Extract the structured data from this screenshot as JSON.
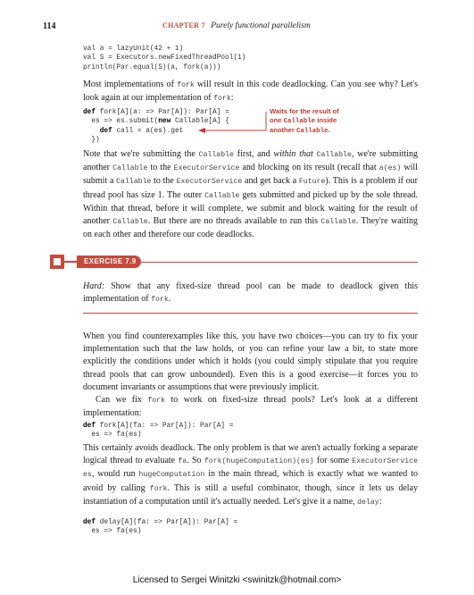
{
  "header": {
    "page_number": "114",
    "chapter_label": "CHAPTER 7",
    "chapter_title": "Purely functional parallelism"
  },
  "code1": {
    "l1": "val a = lazyUnit(42 + 1)",
    "l2": "val S = Executors.newFixedThreadPool(1)",
    "l3": "println(Par.equal(S)(a, fork(a)))"
  },
  "p1": {
    "a": "Most implementations of ",
    "m1": "fork",
    "b": " will result in this code deadlocking. Can you see why? Let's look again at our implementation of ",
    "m2": "fork",
    "c": ":"
  },
  "code2": {
    "l1_kw": "def",
    "l1": " fork[A](a: => Par[A]): Par[A] =",
    "l2a": "  es => es.submit(",
    "l2_kw": "new",
    "l2b": " Callable[A] {",
    "l3a": "    ",
    "l3_kw": "def",
    "l3b": " call = a(es).get",
    "l4": "  })"
  },
  "annotation": {
    "line1": "Waits for the result of",
    "line2a": "one ",
    "line2m": "Callable",
    "line2b": " inside",
    "line3a": "another ",
    "line3m": "Callable",
    "line3b": "."
  },
  "p2": {
    "a": "Note that we're submitting the ",
    "m1": "Callable",
    "b": " first, and ",
    "i1": "within that",
    "c": " ",
    "m2": "Callable",
    "d": ", we're submitting another ",
    "m3": "Callable",
    "e": " to the ",
    "m4": "ExecutorService",
    "f": " and blocking on its result (recall that ",
    "m5": "a(es)",
    "g": " will submit a ",
    "m6": "Callable",
    "h": " to the ",
    "m7": "ExecutorService",
    "j": " and get back a ",
    "m8": "Future",
    "k": "). This is a problem if our thread pool has size 1. The outer ",
    "m9": "Callable",
    "l": " gets submitted and picked up by the sole thread. Within that thread, before it will complete, we submit and block waiting for the result of another ",
    "m10": "Callable",
    "n": ". But there are no threads available to run this ",
    "m11": "Callable",
    "o": ". They're waiting on each other and therefore our code deadlocks."
  },
  "exercise": {
    "badge": "EXERCISE 7.9",
    "hard": "Hard:",
    "text_a": " Show that any fixed-size thread pool can be made to deadlock given this implementation of ",
    "m1": "fork",
    "text_b": "."
  },
  "p3": {
    "text": "When you find counterexamples like this, you have two choices—you can try to fix your implementation such that the law holds, or you can refine your law a bit, to state more explicitly the conditions under which it holds (you could simply stipulate that you require thread pools that can grow unbounded). Even this is a good exercise—it forces you to document invariants or assumptions that were previously implicit."
  },
  "p4": {
    "a": "Can we fix ",
    "m1": "fork",
    "b": " to work on fixed-size thread pools? Let's look at a different implementation:"
  },
  "code3": {
    "l1_kw": "def",
    "l1": " fork[A](fa: => Par[A]): Par[A] =",
    "l2": "  es => fa(es)"
  },
  "p5": {
    "a": "This certainly avoids deadlock. The only problem is that we aren't actually forking a separate logical thread to evaluate ",
    "m1": "fa",
    "b": ". So ",
    "m2": "fork(hugeComputation)(es)",
    "c": " for some ",
    "m3": "ExecutorService es",
    "d": ", would run ",
    "m4": "hugeComputation",
    "e": " in the main thread, which is exactly what we wanted to avoid by calling ",
    "m5": "fork",
    "f": ". This is still a useful combinator, though, since it lets us delay instantiation of a computation until it's actually needed. Let's give it a name, ",
    "m6": "delay",
    "g": ":"
  },
  "code4": {
    "l1_kw": "def",
    "l1": " delay[A](fa: => Par[A]): Par[A] =",
    "l2": "  es => fa(es)"
  },
  "footer": {
    "license": "Licensed to Sergei Winitzki <swinitzk@hotmail.com>"
  },
  "colors": {
    "accent": "#c8493a"
  }
}
